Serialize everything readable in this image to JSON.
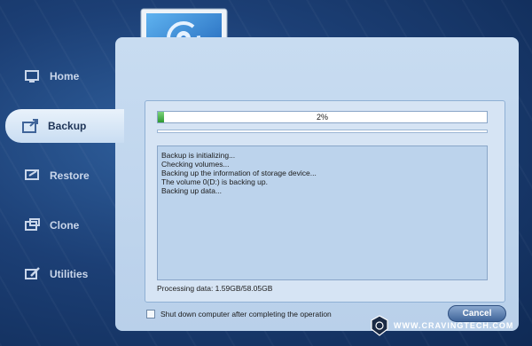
{
  "sidebar": {
    "items": [
      {
        "label": "Home",
        "icon": "home-icon"
      },
      {
        "label": "Backup",
        "icon": "backup-icon",
        "active": true
      },
      {
        "label": "Restore",
        "icon": "restore-icon"
      },
      {
        "label": "Clone",
        "icon": "clone-icon"
      },
      {
        "label": "Utilities",
        "icon": "utilities-icon"
      }
    ]
  },
  "progress": {
    "percent": 2,
    "label": "2%"
  },
  "log": [
    "Backup is initializing...",
    "Checking volumes...",
    "Backing up the information of storage device...",
    "The volume 0(D:) is backing up.",
    "Backing up data..."
  ],
  "processing": {
    "text": "Processing data: 1.59GB/58.05GB"
  },
  "shutdown": {
    "label": "Shut down computer after completing the operation",
    "checked": false
  },
  "cancel_label": "Cancel",
  "watermark": {
    "text": "WWW.CRAVINGTECH.COM"
  },
  "colors": {
    "progress_fill": "#2e9a32",
    "panel_bg": "#c8dcf1",
    "accent": "#3f6499"
  }
}
